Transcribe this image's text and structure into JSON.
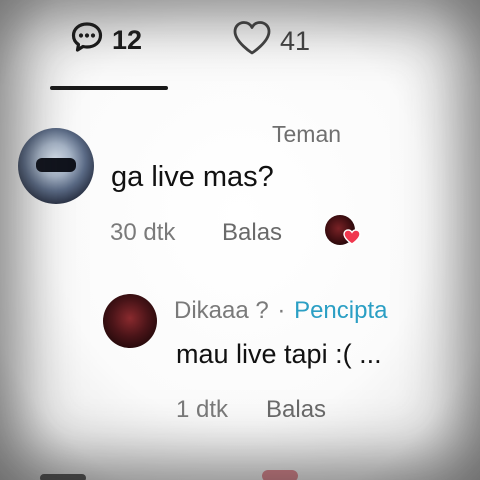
{
  "tabs": {
    "comments_count": "12",
    "likes_count": "41"
  },
  "comment1": {
    "tag": "Teman",
    "text": "ga live mas?",
    "time": "30 dtk",
    "reply": "Balas",
    "creator_liked_icon": "creator-heart-icon"
  },
  "comment2": {
    "author": "Dikaaa ?",
    "separator": "·",
    "badge": "Pencipta",
    "text": "mau live tapi :( ...",
    "time": "1 dtk",
    "reply": "Balas"
  },
  "colors": {
    "creator_badge": "#2b9fc4",
    "heart": "#f0384f"
  }
}
